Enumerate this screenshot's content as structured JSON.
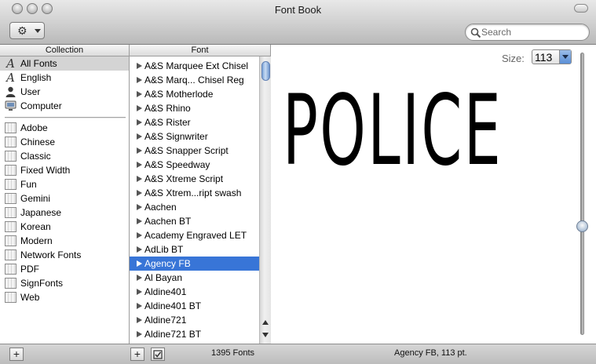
{
  "window": {
    "title": "Font Book"
  },
  "toolbar": {
    "action_icon": "gear-icon",
    "search_placeholder": "Search"
  },
  "collection": {
    "header": "Collection",
    "items": [
      {
        "label": "All Fonts",
        "icon": "font-icon",
        "selected": true
      },
      {
        "label": "English",
        "icon": "font-icon"
      },
      {
        "label": "User",
        "icon": "user-icon"
      },
      {
        "label": "Computer",
        "icon": "computer-icon"
      },
      {
        "label": "Adobe",
        "icon": "book-icon"
      },
      {
        "label": "Chinese",
        "icon": "book-icon"
      },
      {
        "label": "Classic",
        "icon": "book-icon"
      },
      {
        "label": "Fixed Width",
        "icon": "book-icon"
      },
      {
        "label": "Fun",
        "icon": "book-icon"
      },
      {
        "label": "Gemini",
        "icon": "book-icon"
      },
      {
        "label": "Japanese",
        "icon": "book-icon"
      },
      {
        "label": "Korean",
        "icon": "book-icon"
      },
      {
        "label": "Modern",
        "icon": "book-icon"
      },
      {
        "label": "Network Fonts",
        "icon": "book-icon"
      },
      {
        "label": "PDF",
        "icon": "book-icon"
      },
      {
        "label": "SignFonts",
        "icon": "book-icon"
      },
      {
        "label": "Web",
        "icon": "book-icon"
      }
    ]
  },
  "fonts": {
    "header": "Font",
    "items": [
      "A&S Marquee Ext Chisel",
      "A&S Marq... Chisel Reg",
      "A&S Motherlode",
      "A&S Rhino",
      "A&S Rister",
      "A&S Signwriter",
      "A&S Snapper Script",
      "A&S Speedway",
      "A&S Xtreme Script",
      "A&S Xtrem...ript swash",
      "Aachen",
      "Aachen BT",
      "Academy Engraved LET",
      "AdLib BT",
      "Agency FB",
      "Al Bayan",
      "Aldine401",
      "Aldine401 BT",
      "Aldine721",
      "Aldine721 BT"
    ],
    "selected": "Agency FB"
  },
  "preview": {
    "size_label": "Size:",
    "size_value": "113",
    "sample_text": "POLICE"
  },
  "statusbar": {
    "font_count": "1395 Fonts",
    "selection_info": "Agency FB, 113 pt."
  }
}
